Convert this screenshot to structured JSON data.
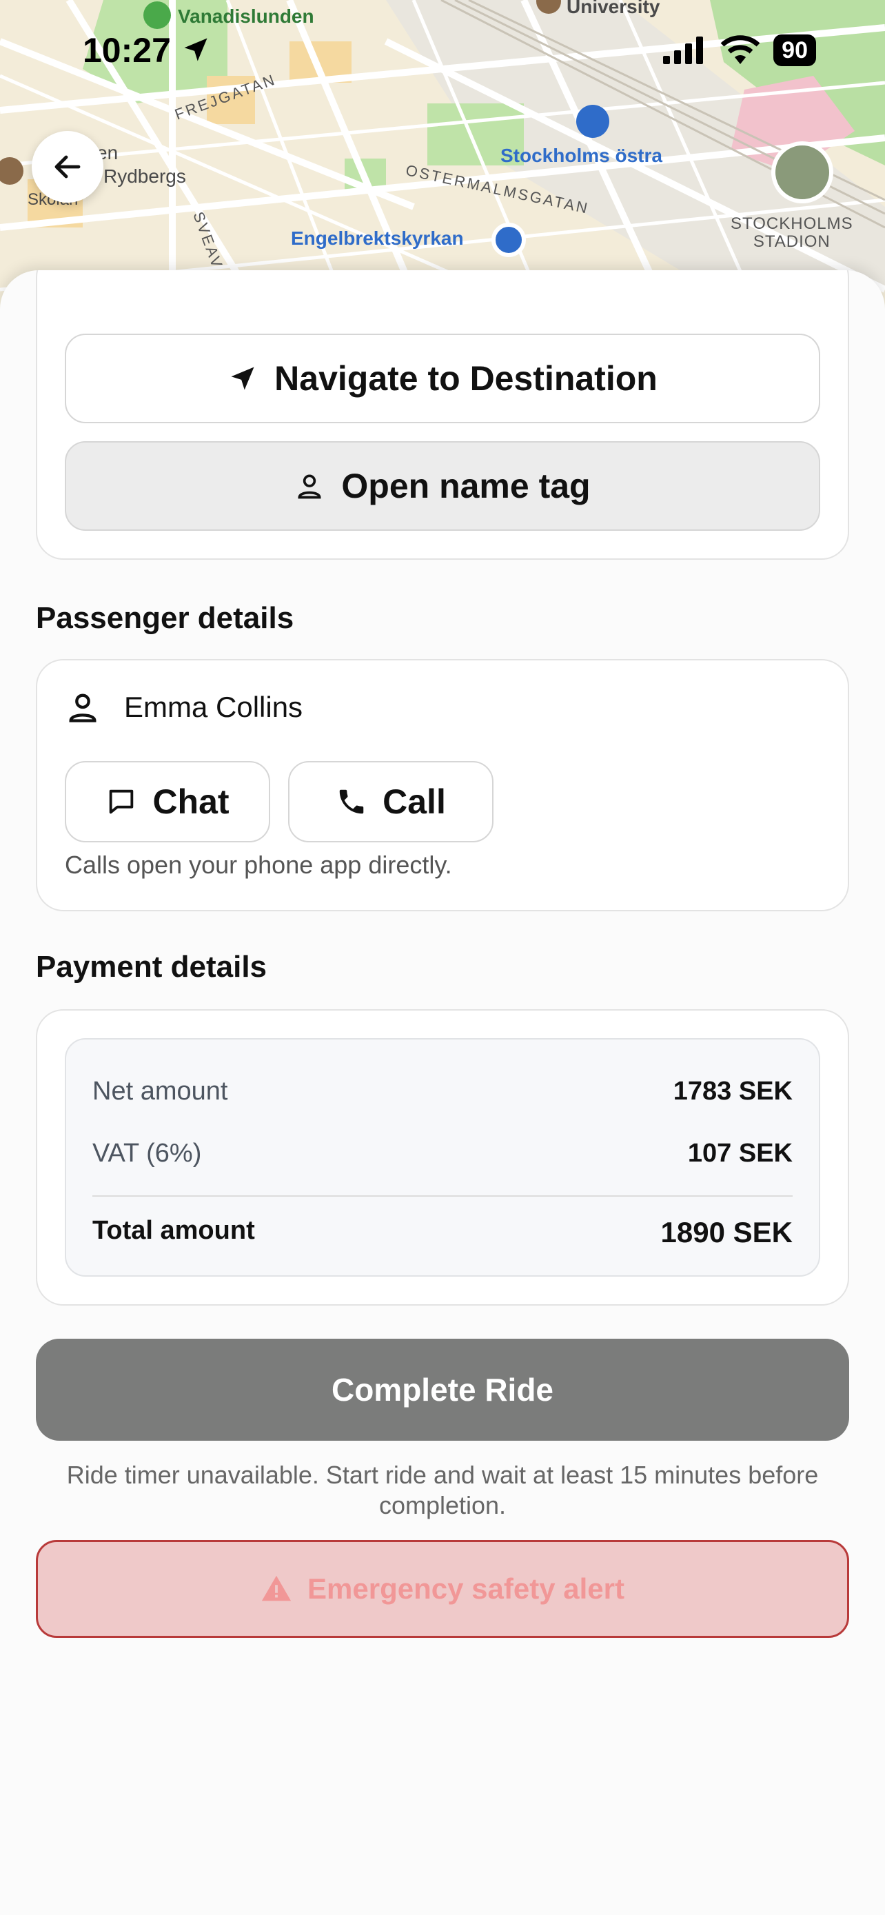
{
  "status_bar": {
    "time": "10:27",
    "battery": "90"
  },
  "map": {
    "labels": {
      "vanadislunden": "Vanadislunden",
      "university": "University",
      "frejgatan": "FREJGATAN",
      "stockholms_ostra": "Stockholms östra",
      "ostermalmsgatan": "OSTERMALMSGATAN",
      "rydbergs": "Rydbergs",
      "en": "en",
      "skolan": "Skolan",
      "sveavagen": "SVEAV",
      "engelbrektskyrkan": "Engelbrektskyrkan",
      "stadion": "STOCKHOLMS\nSTADION"
    }
  },
  "actions": {
    "navigate_label": "Navigate to Destination",
    "name_tag_label": "Open name tag"
  },
  "passenger": {
    "section_title": "Passenger details",
    "name": "Emma Collins",
    "chat_label": "Chat",
    "call_label": "Call",
    "call_hint": "Calls open your phone app directly."
  },
  "payment": {
    "section_title": "Payment details",
    "net_label": "Net amount",
    "net_value": "1783 SEK",
    "vat_label": "VAT (6%)",
    "vat_value": "107 SEK",
    "total_label": "Total amount",
    "total_value": "1890 SEK"
  },
  "complete": {
    "label": "Complete Ride",
    "note": "Ride timer unavailable. Start ride and wait at least 15 minutes before completion."
  },
  "emergency": {
    "label": "Emergency safety alert"
  },
  "colors": {
    "complete_bg": "#7b7c7b",
    "alert_bg": "#efc9c9",
    "alert_border": "#b83a3a",
    "alert_text": "#f19797",
    "map_blue": "#2f6cc9"
  }
}
